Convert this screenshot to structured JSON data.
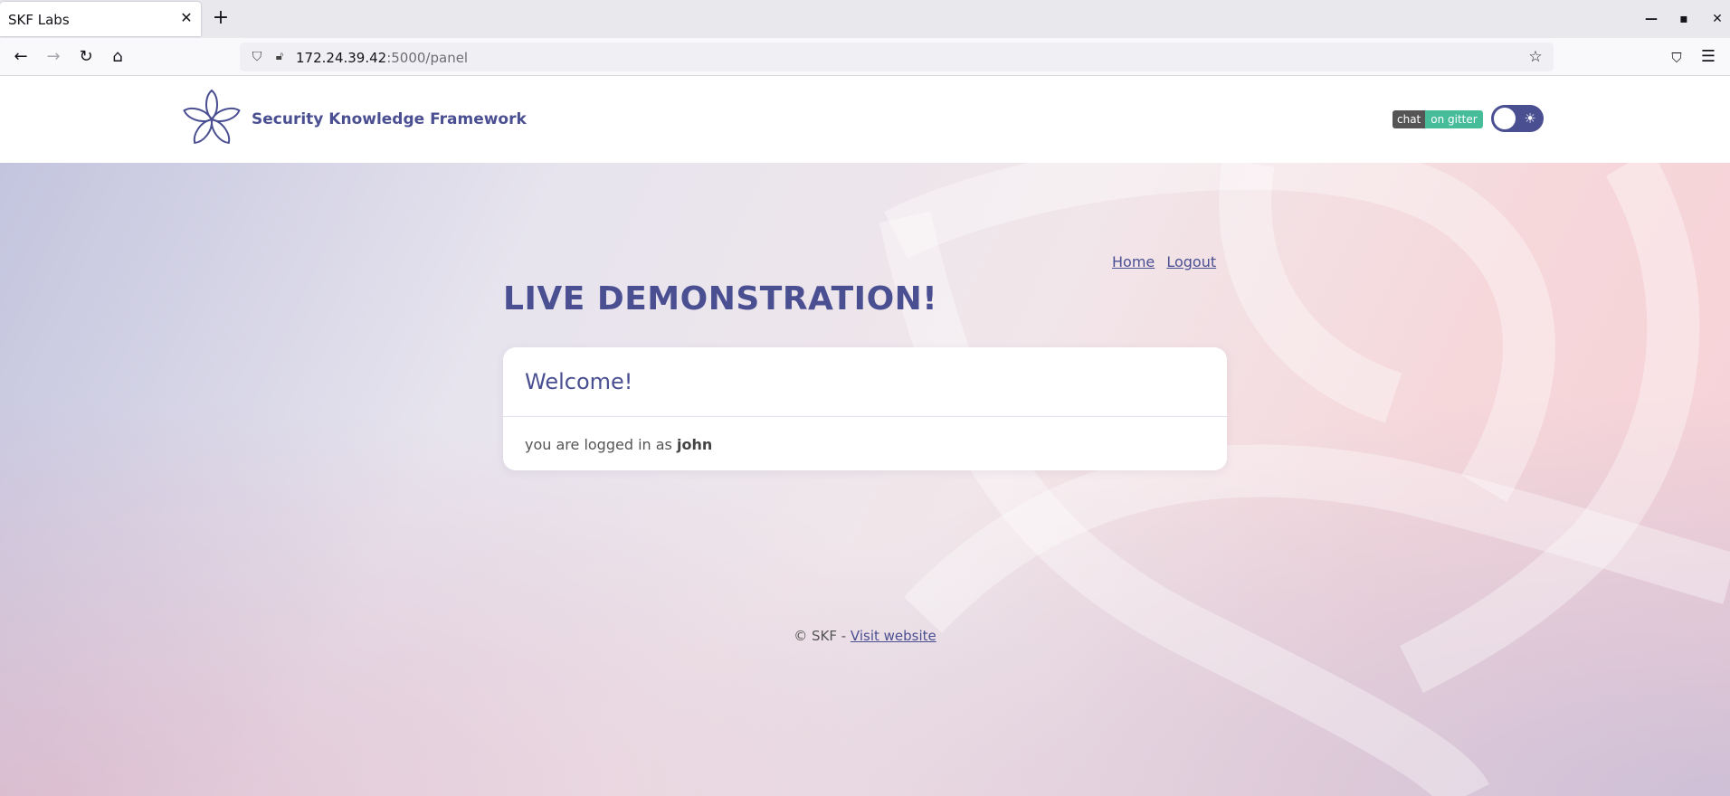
{
  "browser": {
    "tab_title": "SKF Labs",
    "url_host": "172.24.39.42",
    "url_path": ":5000/panel"
  },
  "header": {
    "brand": "Security Knowledge Framework",
    "gitter_left": "chat",
    "gitter_right": "on gitter"
  },
  "nav": {
    "home": "Home",
    "logout": "Logout"
  },
  "main": {
    "headline": "LIVE DEMONSTRATION!",
    "card_title": "Welcome!",
    "logged_in_prefix": "you are logged in as",
    "username": "john"
  },
  "footer": {
    "copyright": "© SKF - ",
    "link": "Visit website"
  },
  "colors": {
    "brand": "#4a4f92",
    "gitter_right": "#46bc99"
  }
}
